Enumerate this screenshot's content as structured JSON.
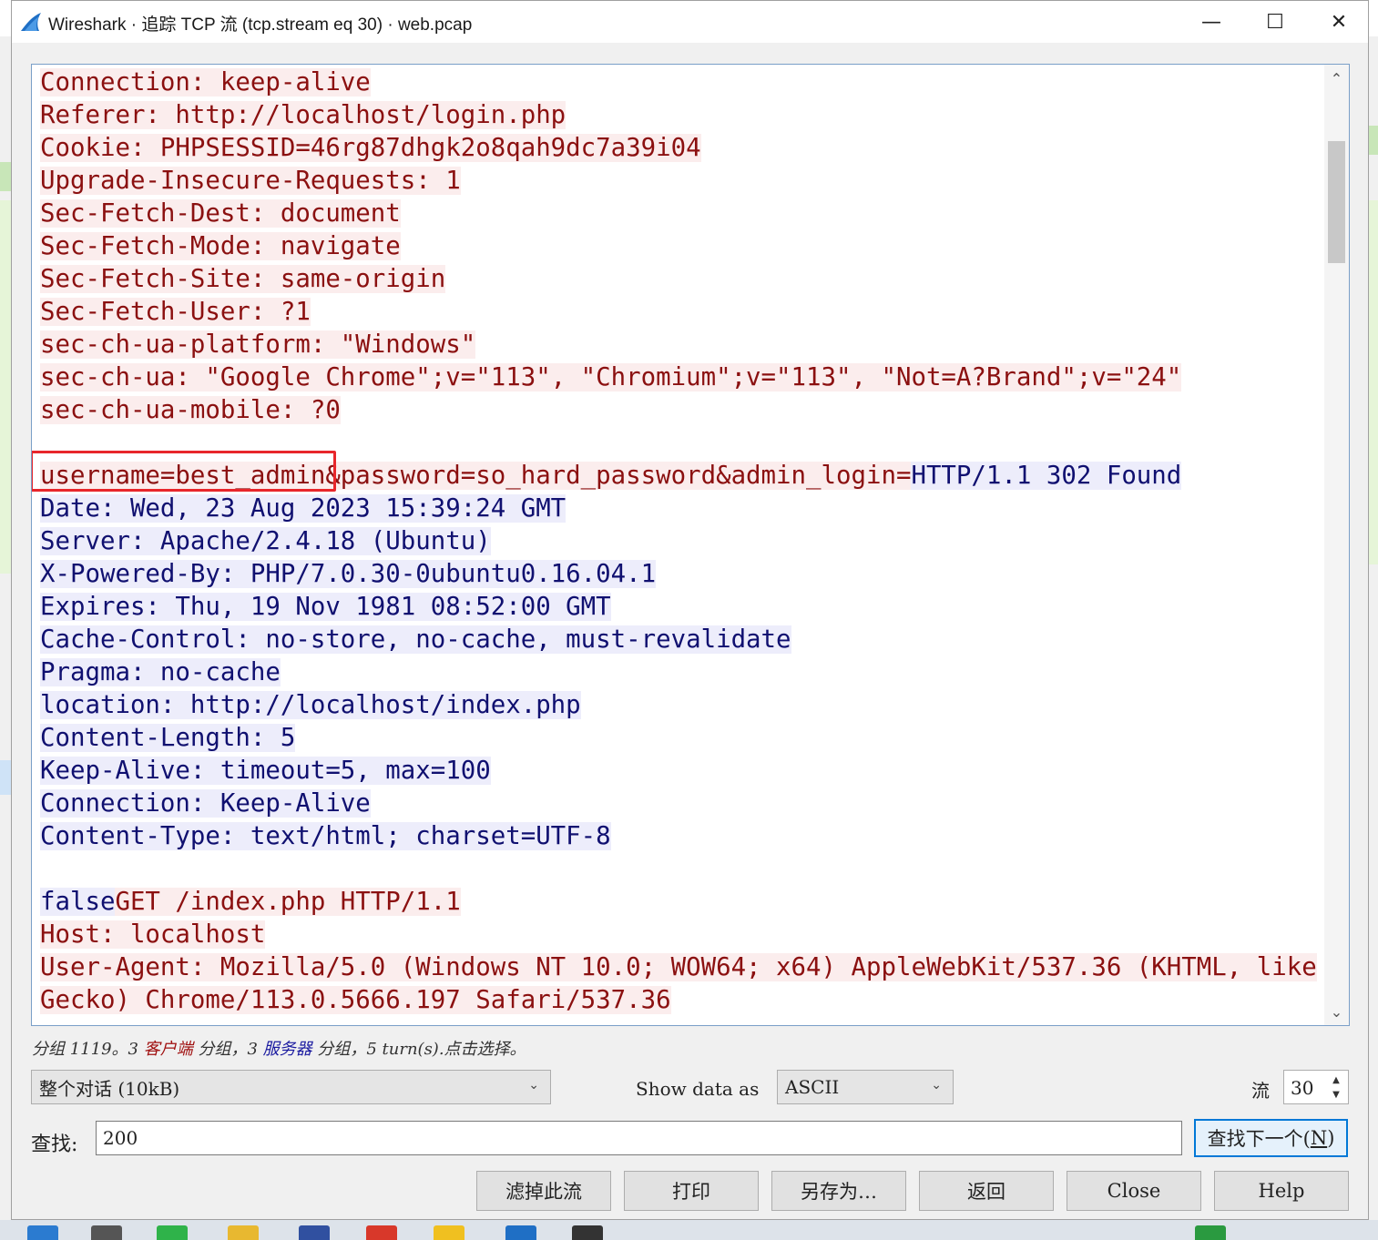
{
  "window": {
    "title": "Wireshark · 追踪 TCP 流 (tcp.stream eq 30) · web.pcap",
    "minimize": "—",
    "maximize": "☐",
    "close": "✕"
  },
  "stream": {
    "lines": [
      [
        {
          "t": "Connection: keep-alive",
          "k": "c"
        }
      ],
      [
        {
          "t": "Referer: http://localhost/login.php",
          "k": "c"
        }
      ],
      [
        {
          "t": "Cookie: PHPSESSID=46rg87dhgk2o8qah9dc7a39i04",
          "k": "c"
        }
      ],
      [
        {
          "t": "Upgrade-Insecure-Requests: 1",
          "k": "c"
        }
      ],
      [
        {
          "t": "Sec-Fetch-Dest: document",
          "k": "c"
        }
      ],
      [
        {
          "t": "Sec-Fetch-Mode: navigate",
          "k": "c"
        }
      ],
      [
        {
          "t": "Sec-Fetch-Site: same-origin",
          "k": "c"
        }
      ],
      [
        {
          "t": "Sec-Fetch-User: ?1",
          "k": "c"
        }
      ],
      [
        {
          "t": "sec-ch-ua-platform: \"Windows\"",
          "k": "c"
        }
      ],
      [
        {
          "t": "sec-ch-ua: \"Google Chrome\";v=\"113\", \"Chromium\";v=\"113\", \"Not=A?Brand\";v=\"24\"",
          "k": "c"
        }
      ],
      [
        {
          "t": "sec-ch-ua-mobile: ?0",
          "k": "c"
        }
      ],
      [
        {
          "t": "",
          "k": "c"
        }
      ],
      [
        {
          "t": "username=best_admin&password=so_hard_password&admin_login=",
          "k": "c"
        },
        {
          "t": "HTTP/1.1 302 Found",
          "k": "s"
        }
      ],
      [
        {
          "t": "Date: Wed, 23 Aug 2023 15:39:24 GMT",
          "k": "s"
        }
      ],
      [
        {
          "t": "Server: Apache/2.4.18 (Ubuntu)",
          "k": "s"
        }
      ],
      [
        {
          "t": "X-Powered-By: PHP/7.0.30-0ubuntu0.16.04.1",
          "k": "s"
        }
      ],
      [
        {
          "t": "Expires: Thu, 19 Nov 1981 08:52:00 GMT",
          "k": "s"
        }
      ],
      [
        {
          "t": "Cache-Control: no-store, no-cache, must-revalidate",
          "k": "s"
        }
      ],
      [
        {
          "t": "Pragma: no-cache",
          "k": "s"
        }
      ],
      [
        {
          "t": "location: http://localhost/index.php",
          "k": "s"
        }
      ],
      [
        {
          "t": "Content-Length: 5",
          "k": "s"
        }
      ],
      [
        {
          "t": "Keep-Alive: timeout=5, max=100",
          "k": "s"
        }
      ],
      [
        {
          "t": "Connection: Keep-Alive",
          "k": "s"
        }
      ],
      [
        {
          "t": "Content-Type: text/html; charset=UTF-8",
          "k": "s"
        }
      ],
      [
        {
          "t": "",
          "k": "s"
        }
      ],
      [
        {
          "t": "false",
          "k": "s"
        },
        {
          "t": "GET /index.php HTTP/1.1",
          "k": "c"
        }
      ],
      [
        {
          "t": "Host: localhost",
          "k": "c"
        }
      ],
      [
        {
          "t": "User-Agent: Mozilla/5.0 (Windows NT 10.0; WOW64; x64) AppleWebKit/537.36 (KHTML, like",
          "k": "c"
        }
      ],
      [
        {
          "t": "Gecko) Chrome/113.0.5666.197 Safari/537.36",
          "k": "c"
        }
      ]
    ],
    "colors": {
      "client_bg": "#fbeded",
      "client_fg": "#8b1010",
      "server_bg": "#ededfb",
      "server_fg": "#101070"
    },
    "scroll_up": "⌃",
    "scroll_down": "⌄"
  },
  "status": {
    "part1": "分组 1119。3 ",
    "client": "客户端",
    "part2": " 分组，3 ",
    "server": "服务器",
    "part3": " 分组，5 turn(s).点击选择。"
  },
  "controls": {
    "conversation_select": "整个对话 (10kB)",
    "show_data_label": "Show data as",
    "show_data_select": "ASCII",
    "stream_label": "流",
    "stream_value": "30",
    "find_label": "查找:",
    "find_value": "200",
    "find_next_main": "查找下一个(",
    "find_next_key": "N",
    "find_next_end": ")"
  },
  "buttons": {
    "filter_out": "滤掉此流",
    "print": "打印",
    "save_as": "另存为…",
    "back": "返回",
    "close": "Close",
    "help": "Help"
  },
  "icons": {
    "app": "wireshark-fin-icon",
    "dropdown": "chevron-down-icon"
  }
}
